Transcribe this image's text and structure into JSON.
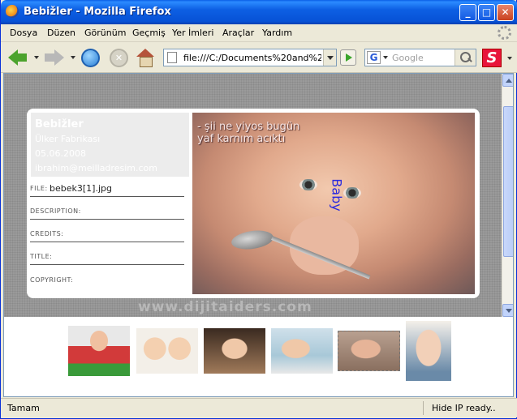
{
  "window": {
    "title": "Bebižler - Mozilla Firefox"
  },
  "menu": [
    "Dosya",
    "Düzen",
    "Görünüm",
    "Geçmiş",
    "Yer İmleri",
    "Araçlar",
    "Yardım"
  ],
  "toolbar": {
    "url": "file:///C:/Documents%20and%20S",
    "search_placeholder": "Google",
    "search_engine_letter": "G",
    "addon_letter": "S"
  },
  "gallery": {
    "info": {
      "title": "Bebižler",
      "author": "Ülker Fabrikası",
      "date": "05.06.2008",
      "email": "ibrahim@meilladresim.com"
    },
    "fields": [
      {
        "label": "FILE:",
        "value": "bebek3[1].jpg"
      },
      {
        "label": "DESCRIPTION:",
        "value": ""
      },
      {
        "label": "CREDITS:",
        "value": ""
      },
      {
        "label": "TITLE:",
        "value": ""
      },
      {
        "label": "COPYRIGHT:",
        "value": ""
      }
    ],
    "photo_caption_line1": "- şii ne yiyos bugün",
    "photo_caption_line2": "yaf karnım acıktı",
    "photo_vertical_text": "Baby",
    "watermark": "www.dijitaiders.com"
  },
  "status": {
    "left": "Tamam",
    "right": "Hide IP ready.."
  }
}
